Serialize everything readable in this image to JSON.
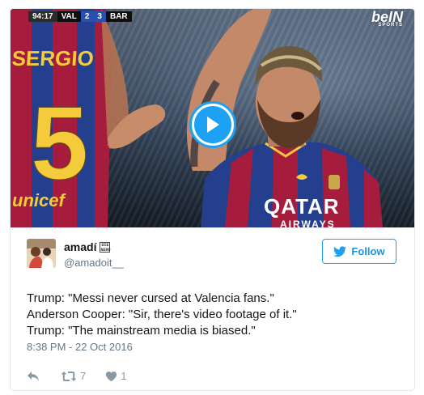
{
  "media": {
    "scoreboard": {
      "clock": "94:17",
      "home": "VAL",
      "home_score": "2",
      "away_score": "3",
      "away": "BAR"
    },
    "broadcaster": {
      "name": "beIN",
      "sub": "SPORTS"
    },
    "jersey": {
      "name": "SERGIO",
      "number": "5",
      "sponsor": "unicef"
    },
    "shirt": {
      "sponsor": "QATAR",
      "sponsor_sub": "AIRWAYS"
    }
  },
  "tweet": {
    "user": {
      "name": "amadí",
      "handle": "@amadoit__",
      "badge": "DIE NERD"
    },
    "follow_label": "Follow",
    "lines": [
      "Trump: \"Messi never cursed at Valencia fans.\"",
      "Anderson Cooper: \"Sir, there's video footage of it.\"",
      "Trump: \"The mainstream media is biased.\""
    ],
    "timestamp": "8:38 PM - 22 Oct 2016",
    "stats": {
      "retweets": "7",
      "likes": "1"
    }
  },
  "colors": {
    "accent": "#1da1f2",
    "text": "#14171a",
    "muted": "#657786",
    "icon": "#8899a6",
    "border": "#e1e8ed"
  },
  "icons": {
    "play": "play-icon",
    "follow": "twitter-bird-icon",
    "reply": "reply-icon",
    "retweet": "retweet-icon",
    "like": "heart-icon"
  }
}
